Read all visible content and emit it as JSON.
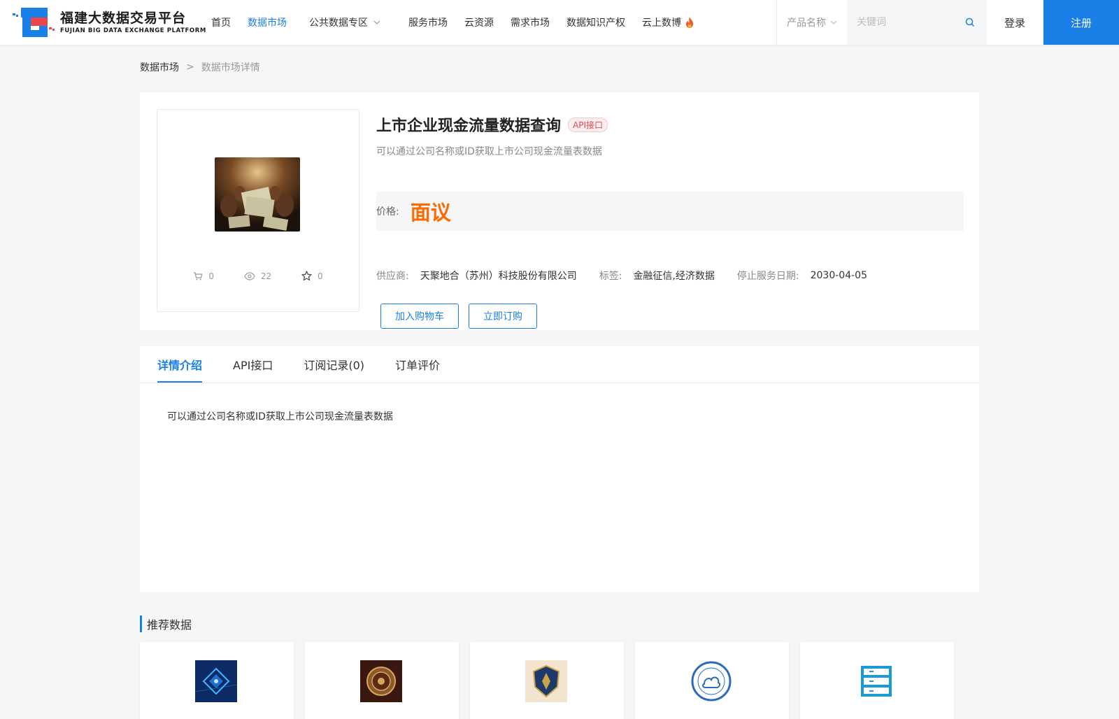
{
  "header": {
    "logo_cn": "福建大数据交易平台",
    "logo_en": "FUJIAN BIG DATA EXCHANGE  PLATFORM",
    "nav": [
      {
        "label": "首页",
        "active": false
      },
      {
        "label": "数据市场",
        "active": true
      },
      {
        "label": "公共数据专区",
        "active": false
      },
      {
        "label": "服务市场",
        "active": false
      },
      {
        "label": "云资源",
        "active": false
      },
      {
        "label": "需求市场",
        "active": false
      },
      {
        "label": "数据知识产权",
        "active": false
      },
      {
        "label": "云上数博",
        "active": false
      }
    ],
    "search": {
      "select_label": "产品名称",
      "placeholder": "关键词",
      "value": ""
    },
    "login": "登录",
    "register": "注册"
  },
  "breadcrumb": {
    "root": "数据市场",
    "separator": ">",
    "current": "数据市场详情"
  },
  "product": {
    "title": "上市企业现金流量数据查询",
    "badge": "API接口",
    "subtitle": "可以通过公司名称或ID获取上市公司现金流量表数据",
    "price_label": "价格:",
    "price_value": "面议",
    "stats": {
      "cart": "0",
      "views": "22",
      "favorites": "0"
    },
    "supplier_label": "供应商:",
    "supplier": "天聚地合（苏州）科技股份有限公司",
    "tags_label": "标签:",
    "tags": "金融征信,经济数据",
    "stop_date_label": "停止服务日期:",
    "stop_date": "2030-04-05",
    "add_cart": "加入购物车",
    "buy_now": "立即订购"
  },
  "tabs": [
    {
      "label": "详情介绍",
      "active": true
    },
    {
      "label": "API接口",
      "active": false
    },
    {
      "label": "订阅记录(0)",
      "active": false
    },
    {
      "label": "订单评价",
      "active": false
    }
  ],
  "detail_text": "可以通过公司名称或ID获取上市公司现金流量表数据",
  "recommend": {
    "title": "推荐数据"
  },
  "colors": {
    "accent": "#1a7fe6",
    "price": "#ff6a00",
    "badge": "#e8474c"
  }
}
